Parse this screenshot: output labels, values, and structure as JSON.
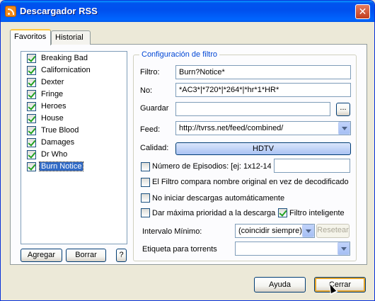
{
  "window": {
    "title": "Descargador RSS"
  },
  "tabs": [
    {
      "label": "Favoritos",
      "active": true
    },
    {
      "label": "Historial",
      "active": false
    }
  ],
  "shows": [
    {
      "label": "Breaking Bad",
      "checked": true
    },
    {
      "label": "Californication",
      "checked": true
    },
    {
      "label": "Dexter",
      "checked": true
    },
    {
      "label": "Fringe",
      "checked": true
    },
    {
      "label": "Heroes",
      "checked": true
    },
    {
      "label": "House",
      "checked": true
    },
    {
      "label": "True Blood",
      "checked": true
    },
    {
      "label": "Damages",
      "checked": true
    },
    {
      "label": "Dr Who",
      "checked": true
    },
    {
      "label": "Burn Notice",
      "checked": true,
      "selected": true
    }
  ],
  "list_buttons": {
    "add": "Agregar",
    "remove": "Borrar",
    "help": "?"
  },
  "filter": {
    "group_title": "Configuración de filtro",
    "filtro_label": "Filtro:",
    "filtro_value": "Burn?Notice*",
    "no_label": "No:",
    "no_value": "*AC3*|*720*|*264*|*hr*1*HR*",
    "guardar_label": "Guardar",
    "guardar_value": "",
    "browse_label": "...",
    "feed_label": "Feed:",
    "feed_value": "http://tvrss.net/feed/combined/",
    "calidad_label": "Calidad:",
    "calidad_value": "HDTV",
    "episodes_label": "Número de Episodios: [ej: 1x12-14]",
    "episodes_checked": false,
    "episodes_value": "",
    "compare_label": "El Filtro compara nombre original en vez de decodificado",
    "compare_checked": false,
    "no_autostart_label": "No iniciar descargas automáticamente",
    "no_autostart_checked": false,
    "priority_label": "Dar máxima prioridad a la descarga",
    "priority_checked": false,
    "smart_label": "Filtro inteligente",
    "smart_checked": true,
    "interval_label": "Intervalo Mínimo:",
    "interval_value": "(coincidir siempre)",
    "reset_label": "Resetear",
    "tag_label": "Etiqueta para torrents",
    "tag_value": ""
  },
  "footer": {
    "help": "Ayuda",
    "close": "Cerrar"
  },
  "icons": {
    "title": "rss-feed-icon",
    "close": "close-icon",
    "cursor": "mouse-pointer-icon"
  }
}
